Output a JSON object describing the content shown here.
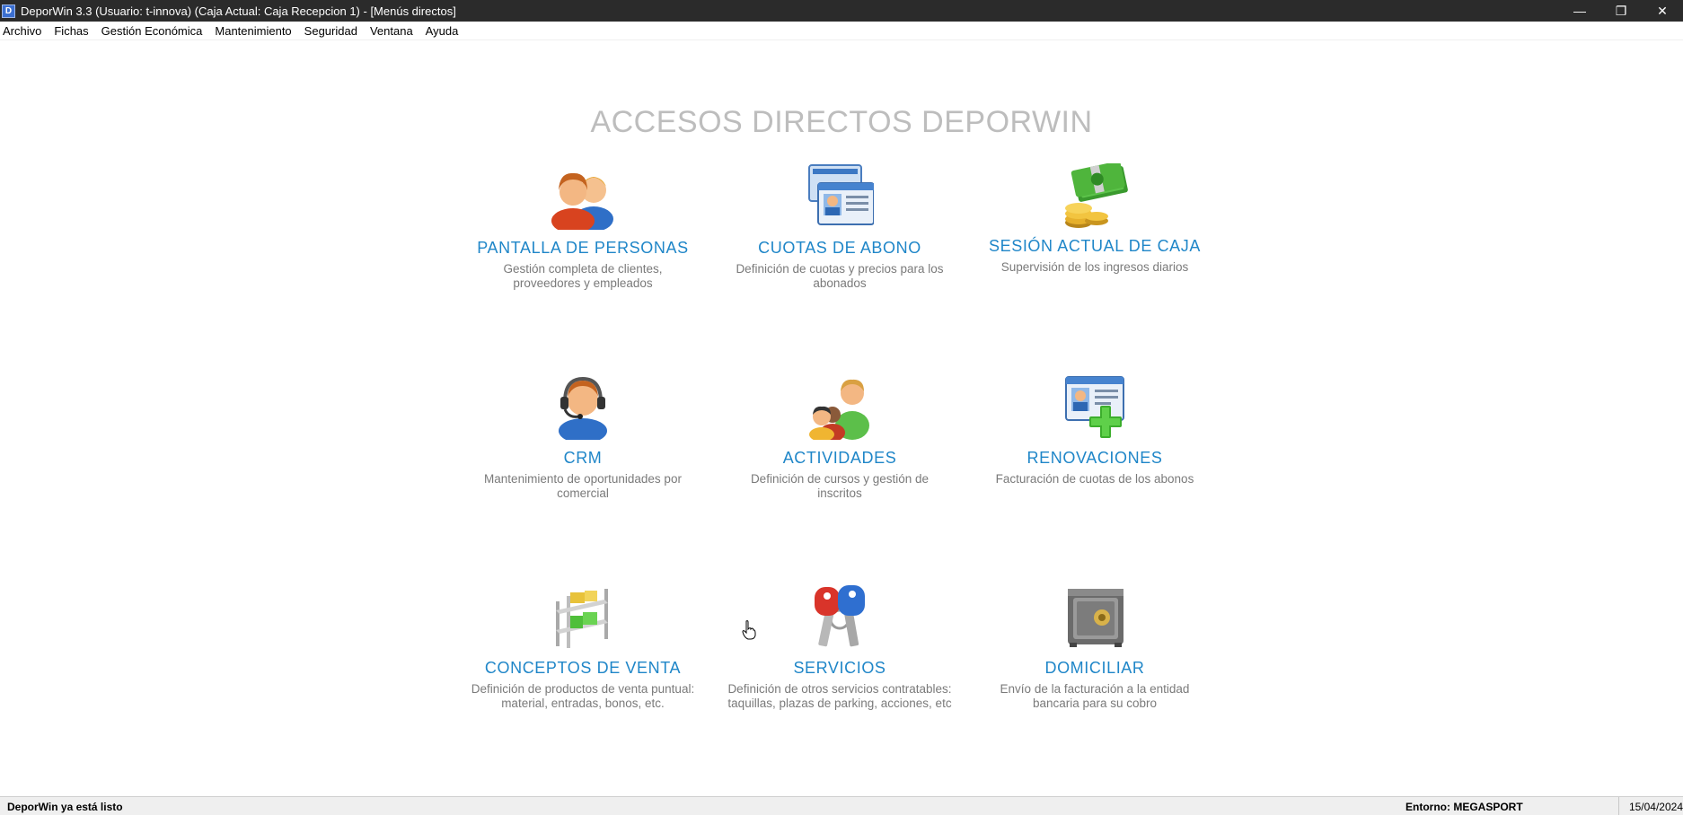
{
  "window": {
    "title": "DeporWin 3.3  (Usuario: t-innova)  (Caja Actual: Caja Recepcion 1) - [Menús directos]",
    "app_icon_letter": "D",
    "controls": {
      "minimize": "—",
      "restore": "❐",
      "close": "✕"
    }
  },
  "menu": {
    "items": [
      "Archivo",
      "Fichas",
      "Gestión Económica",
      "Mantenimiento",
      "Seguridad",
      "Ventana",
      "Ayuda"
    ]
  },
  "main": {
    "title": "ACCESOS DIRECTOS DEPORWIN",
    "tiles": [
      {
        "icon": "people-icon",
        "label": "PANTALLA DE PERSONAS",
        "desc": "Gestión completa de clientes, proveedores y empleados"
      },
      {
        "icon": "id-cards-icon",
        "label": "CUOTAS DE ABONO",
        "desc": "Definición de cuotas y precios para los abonados"
      },
      {
        "icon": "money-coins-icon",
        "label": "SESIÓN ACTUAL DE CAJA",
        "desc": "Supervisión de los ingresos diarios"
      },
      {
        "icon": "headset-operator-icon",
        "label": "CRM",
        "desc": "Mantenimiento de oportunidades por comercial"
      },
      {
        "icon": "group-icon",
        "label": "ACTIVIDADES",
        "desc": "Definición de cursos y gestión de inscritos"
      },
      {
        "icon": "id-card-add-icon",
        "label": "RENOVACIONES",
        "desc": "Facturación de cuotas de los abonos"
      },
      {
        "icon": "shelf-boxes-icon",
        "label": "CONCEPTOS DE VENTA",
        "desc": "Definición de productos de venta puntual: material, entradas, bonos, etc."
      },
      {
        "icon": "keys-icon",
        "label": "SERVICIOS",
        "desc": "Definición de otros servicios contratables: taquillas, plazas de parking, acciones, etc"
      },
      {
        "icon": "safe-icon",
        "label": "DOMICILIAR",
        "desc": "Envío de la facturación a la entidad bancaria para su cobro"
      }
    ]
  },
  "status": {
    "message": "DeporWin ya está listo",
    "environment": "Entorno: MEGASPORT",
    "date": "15/04/2024"
  },
  "colors": {
    "titlebar": "#2b2b2b",
    "accent_label": "#1f86c8",
    "heading": "#bdbdbd",
    "desc": "#7a7a7a"
  }
}
